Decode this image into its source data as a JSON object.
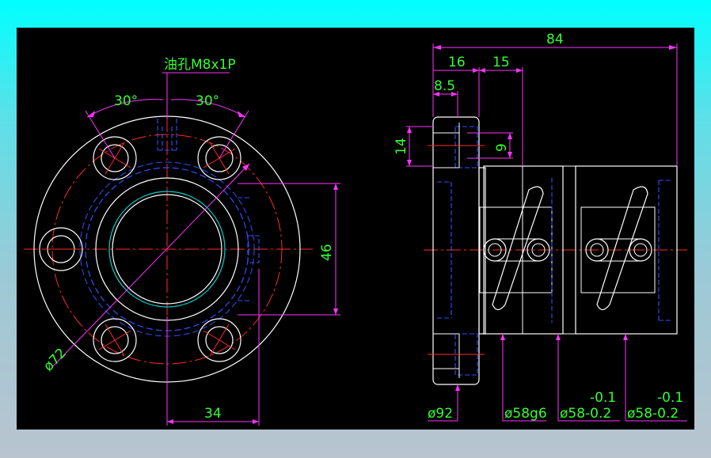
{
  "drawing": {
    "background": "#000000",
    "colors": {
      "outline": "#ffffff",
      "center": "#ff2a2a",
      "hidden": "#3050ff",
      "dim": "#ff33ff",
      "dimText": "#33ff33",
      "thread": "#00d0d0"
    },
    "front_view": {
      "oil_hole": "油孔M8x1P",
      "angle_left": "30°",
      "angle_right": "30°",
      "diameter_bolt_circle": "ø72",
      "height_46": "46",
      "offset_34": "34"
    },
    "side_view": {
      "length_84": "84",
      "flange_16": "16",
      "step_15": "15",
      "offset_8_5": "8.5",
      "hole_14": "14",
      "hole_9": "9",
      "flange_dia": "ø92",
      "fit_dia": "ø58g6",
      "body_dia_1": "ø58-0.2",
      "body_tol_1": "-0.1",
      "body_dia_2": "ø58-0.2",
      "body_tol_2": "-0.1"
    }
  }
}
